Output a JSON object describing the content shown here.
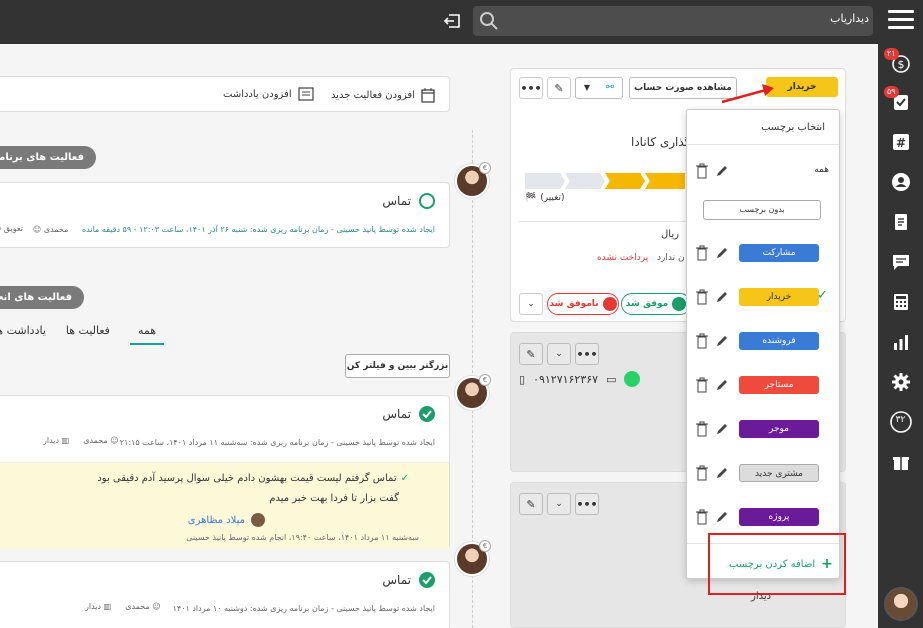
{
  "topbar": {
    "app_title": "دیداریاب",
    "search_placeholder": ""
  },
  "rail": {
    "badges": {
      "money": "۲۱",
      "tasks": "۵۹"
    },
    "counter_label": "۳۲",
    "icons": [
      "dollar-icon",
      "checklist-icon",
      "hash-icon",
      "user-icon",
      "document-icon",
      "chat-icon",
      "calculator-icon",
      "chart-icon",
      "gear-icon",
      "counter-icon",
      "gift-icon"
    ]
  },
  "toolbar": {
    "add_activity": "افزودن فعالیت جدید",
    "add_note": "افزودن یادداشت"
  },
  "sections": {
    "planned_activities": "فعالیت های برنامه ریزی شده",
    "done_activities": "فعالیت های انجام شده"
  },
  "tabs": {
    "all": "همه",
    "activities": "فعالیت ها",
    "notes": "یادداشت ها"
  },
  "filter_button": "بزرگتر ببین و فیلتر کن",
  "activity1": {
    "title": "تماس",
    "meta": "ایجاد شده توسط پانیذ حسینی - زمان برنامه ریزی شده: شنبه ۲۶ آذر ۱۴۰۱، ساعت ۱۲:۰۳ - ۵۹ دقیقه مانده",
    "owner": "محمدی",
    "postpone": "تعویق"
  },
  "activity2": {
    "title": "تماس",
    "meta": "ایجاد شده توسط پانیذ حسینی - زمان برنامه ریزی شده: سه‌شنبه ۱۱ مرداد ۱۴۰۱، ساعت ۲۱:۱۵",
    "owner": "محمدی",
    "company": "دیدار",
    "note_line1": "تماس گرفتم لیست قیمت بهشون دادم خیلی سوال پرسید آدم دقیقی بود",
    "note_line2": "گفت بزار تا فردا بهت خبر میدم",
    "mention": "میلاد مظاهری",
    "note_meta": "سه‌شنبه ۱۱ مرداد ۱۴۰۱، ساعت ۱۹:۴۰، انجام شده توسط پانیذ حسینی"
  },
  "activity3": {
    "title": "تماس",
    "meta": "ایجاد شده توسط پانیذ حسینی - زمان برنامه ریزی شده: دوشنبه ۱۰ مرداد ۱۴۰۱",
    "owner": "محمدی",
    "company": "دیدار"
  },
  "deal_card": {
    "buyer_tag": "خریدار",
    "view_invoice": "مشاهده صورت حساب",
    "title_fragment": "گذاری کانادا",
    "change": "(تغییر)",
    "currency": "ریال",
    "no_value": "ن ندارد",
    "unpaid": "پرداخت نشده",
    "won": "موفق شد",
    "lost": "ناموفق شد"
  },
  "contact_card": {
    "phone": "۰۹۱۲۷۱۶۲۳۶۷"
  },
  "tag_dropdown": {
    "header": "انتخاب برچسب",
    "all": "همه",
    "no_tag": "بدون برچسب",
    "tags": [
      {
        "label": "مشارکت",
        "color": "#3a7bd5",
        "checked": false
      },
      {
        "label": "خریدار",
        "color": "#f5c518",
        "checked": true
      },
      {
        "label": "فروشنده",
        "color": "#3a7bd5",
        "checked": false
      },
      {
        "label": "مستاجر",
        "color": "#ef4b3c",
        "checked": false
      },
      {
        "label": "موجر",
        "color": "#6a1b9a",
        "checked": false
      },
      {
        "label": "مشتری جدید",
        "color": "#dcdcdc",
        "checked": false
      },
      {
        "label": "پروژه",
        "color": "#6a1b9a",
        "checked": false
      }
    ],
    "add_tag": "اضافه کردن برچسب"
  },
  "bottom_label": "دیدار",
  "colors": {
    "topbar": "#333333",
    "accent_green": "#1a9e6b",
    "highlight_red": "#e02020",
    "note_bg": "#fdf8d8"
  }
}
